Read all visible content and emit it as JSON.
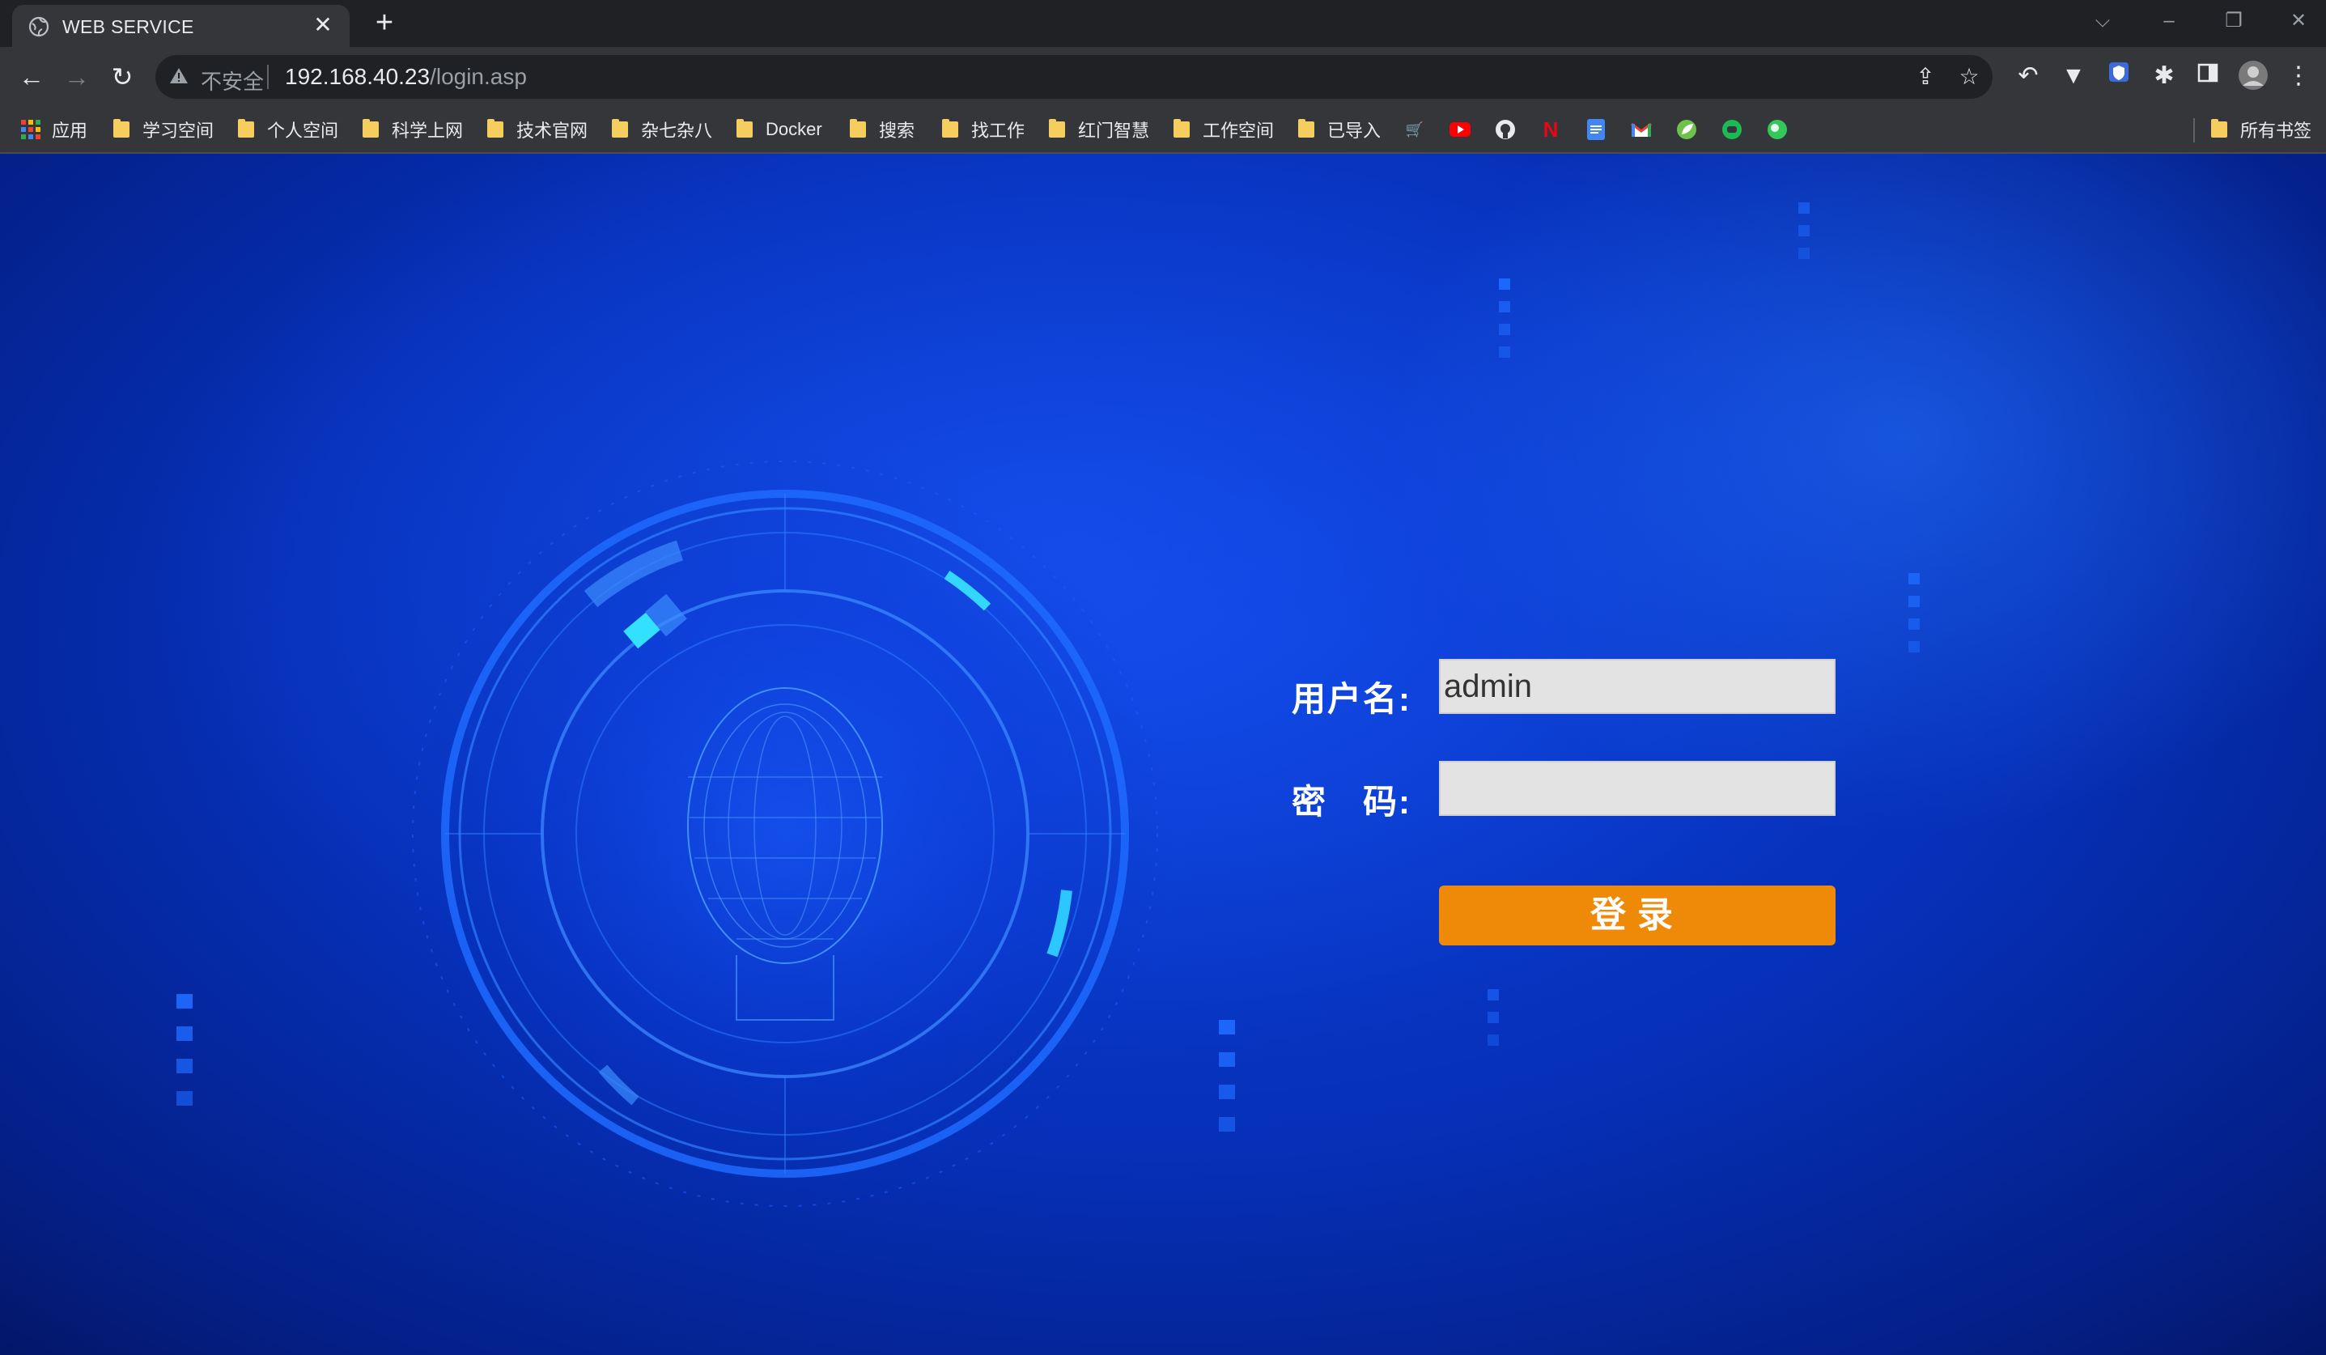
{
  "tab": {
    "title": "WEB SERVICE",
    "close": "✕",
    "new_tab": "+"
  },
  "toolbar": {
    "insecure_label": "不安全",
    "url_host": "192.168.40.23",
    "url_path": "/login.asp"
  },
  "bookmarks": {
    "apps_label": "应用",
    "folders": [
      "学习空间",
      "个人空间",
      "科学上网",
      "技术官网",
      "杂七杂八",
      "Docker",
      "搜索",
      "找工作",
      "红门智慧",
      "工作空间",
      "已导入"
    ],
    "all_bookmarks_label": "所有书签",
    "site_icons": [
      "shopping-cart-icon",
      "youtube-icon",
      "github-icon",
      "netflix-icon",
      "docs-icon",
      "gmail-icon",
      "leaf-icon",
      "chat-icon",
      "green-circle-icon"
    ]
  },
  "login": {
    "username_label": "用户名:",
    "password_label": "密　码:",
    "username_value": "admin",
    "password_value": "",
    "submit_label": "登录"
  },
  "colors": {
    "button": "#ee8a08",
    "background": "#0630b8",
    "input": "#e3e3e3"
  }
}
